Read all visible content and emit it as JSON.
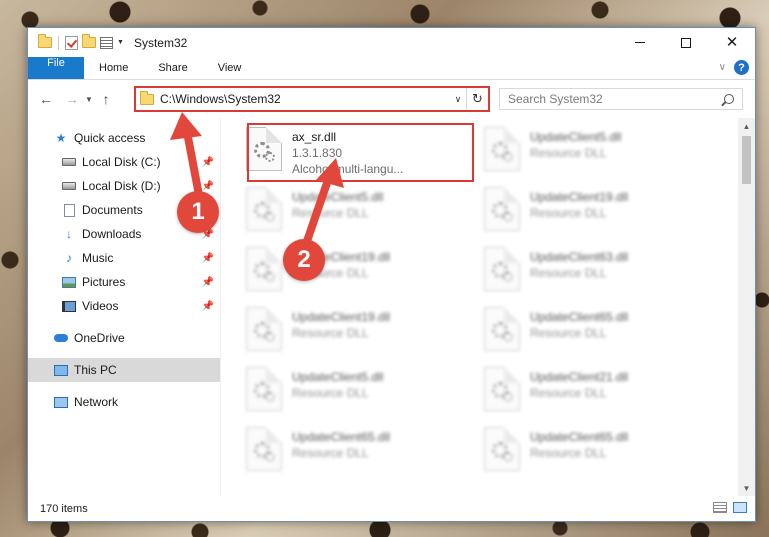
{
  "window": {
    "title": "System32",
    "min_glyph": "",
    "close_glyph": "✕"
  },
  "ribbon": {
    "tabs": [
      "File",
      "Home",
      "Share",
      "View"
    ],
    "help": "?"
  },
  "address": {
    "path": "C:\\Windows\\System32"
  },
  "search": {
    "placeholder": "Search System32"
  },
  "nav": {
    "quick_access": "Quick access",
    "items": [
      {
        "label": "Local Disk (C:)",
        "icon": "disk-icon"
      },
      {
        "label": "Local Disk (D:)",
        "icon": "disk-icon"
      },
      {
        "label": "Documents",
        "icon": "documents-icon"
      },
      {
        "label": "Downloads",
        "icon": "downloads-icon"
      },
      {
        "label": "Music",
        "icon": "music-icon"
      },
      {
        "label": "Pictures",
        "icon": "pictures-icon"
      },
      {
        "label": "Videos",
        "icon": "videos-icon"
      }
    ],
    "onedrive": "OneDrive",
    "this_pc": "This PC",
    "network": "Network"
  },
  "files": [
    {
      "name": "ax_sr.dll",
      "version": "1.3.1.830",
      "description": "Alcohol multi-langu..."
    },
    {
      "name": "UpdateClient5.dll",
      "type": "Resource DLL"
    },
    {
      "name": "UpdateClient5.dll",
      "type": "Resource DLL"
    },
    {
      "name": "UpdateClient19.dll",
      "type": "Resource DLL"
    },
    {
      "name": "UpdateClient19.dll",
      "type": "Resource DLL"
    },
    {
      "name": "UpdateClient63.dll",
      "type": "Resource DLL"
    },
    {
      "name": "UpdateClient19.dll",
      "type": "Resource DLL"
    },
    {
      "name": "UpdateClient65.dll",
      "type": "Resource DLL"
    },
    {
      "name": "UpdateClient5.dll",
      "type": "Resource DLL"
    },
    {
      "name": "UpdateClient21.dll",
      "type": "Resource DLL"
    },
    {
      "name": "UpdateClient65.dll",
      "type": "Resource DLL"
    },
    {
      "name": "UpdateClient65.dll",
      "type": "Resource DLL"
    }
  ],
  "status": {
    "item_count": "170 items"
  },
  "annotations": [
    "1",
    "2"
  ],
  "colors": {
    "accent": "#1979ca",
    "highlight": "#d93b34",
    "badge": "#e2473b"
  }
}
